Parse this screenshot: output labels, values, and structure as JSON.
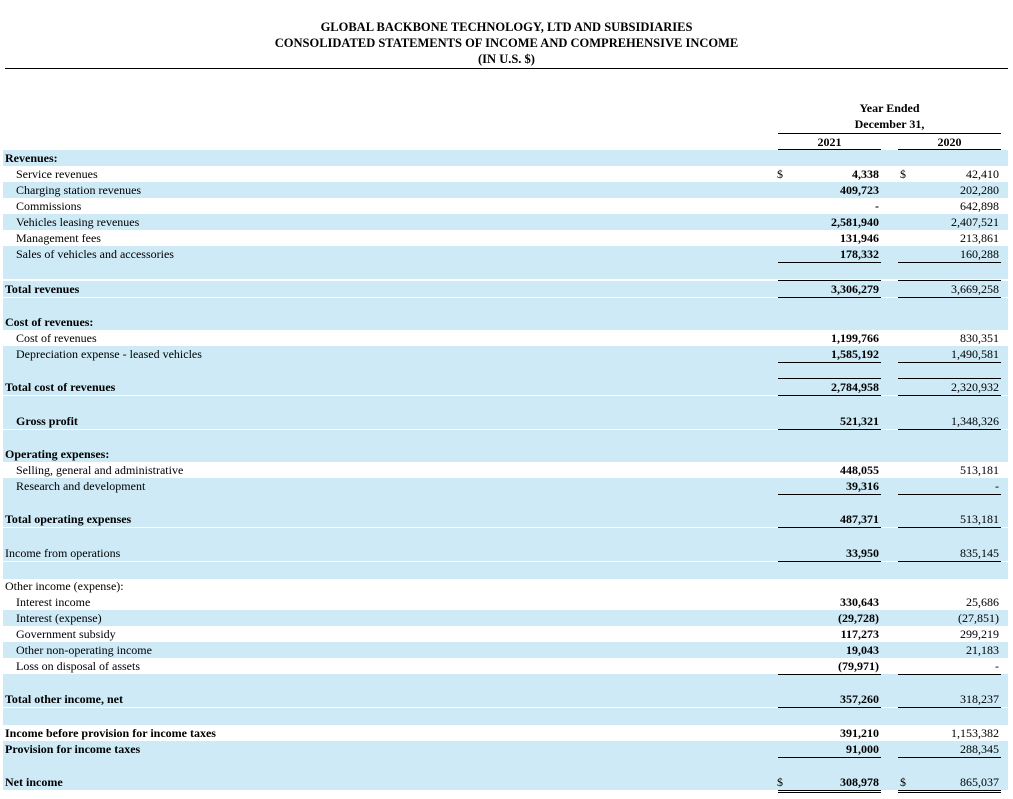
{
  "header": {
    "company": "GLOBAL BACKBONE TECHNOLOGY, LTD AND SUBSIDIARIES",
    "statement": "CONSOLIDATED STATEMENTS OF INCOME AND COMPREHENSIVE INCOME",
    "currency": "(IN U.S. $)"
  },
  "columns": {
    "period_line1": "Year Ended",
    "period_line2": "December 31,",
    "year_a": "2021",
    "year_b": "2020"
  },
  "rows": [
    {
      "label": "Revenues:",
      "v2021": "",
      "v2020": ""
    },
    {
      "label": "Service revenues",
      "cur2021": "$",
      "v2021": "4,338",
      "cur2020": "$",
      "v2020": "42,410"
    },
    {
      "label": "Charging station revenues",
      "v2021": "409,723",
      "v2020": "202,280"
    },
    {
      "label": "Commissions",
      "v2021": "-",
      "v2020": "642,898"
    },
    {
      "label": "Vehicles leasing revenues",
      "v2021": "2,581,940",
      "v2020": "2,407,521"
    },
    {
      "label": "Management fees",
      "v2021": "131,946",
      "v2020": "213,861"
    },
    {
      "label": "Sales of vehicles and accessories",
      "v2021": "178,332",
      "v2020": "160,288"
    },
    {
      "label": "Total revenues",
      "v2021": "3,306,279",
      "v2020": "3,669,258"
    },
    {
      "label": "Cost of revenues:",
      "v2021": "",
      "v2020": ""
    },
    {
      "label": "Cost of revenues",
      "v2021": "1,199,766",
      "v2020": "830,351"
    },
    {
      "label": "Depreciation expense - leased vehicles",
      "v2021": "1,585,192",
      "v2020": "1,490,581"
    },
    {
      "label": "Total cost of revenues",
      "v2021": "2,784,958",
      "v2020": "2,320,932"
    },
    {
      "label": "Gross profit",
      "v2021": "521,321",
      "v2020": "1,348,326"
    },
    {
      "label": "Operating expenses:",
      "v2021": "",
      "v2020": ""
    },
    {
      "label": "Selling, general and administrative",
      "v2021": "448,055",
      "v2020": "513,181"
    },
    {
      "label": "Research and development",
      "v2021": "39,316",
      "v2020": "-"
    },
    {
      "label": "Total operating expenses",
      "v2021": "487,371",
      "v2020": "513,181"
    },
    {
      "label": "Income from operations",
      "v2021": "33,950",
      "v2020": "835,145"
    },
    {
      "label": "Other income (expense):",
      "v2021": "",
      "v2020": ""
    },
    {
      "label": "Interest income",
      "v2021": "330,643",
      "v2020": "25,686"
    },
    {
      "label": "Interest (expense)",
      "v2021": "(29,728)",
      "v2020": "(27,851)"
    },
    {
      "label": "Government subsidy",
      "v2021": "117,273",
      "v2020": "299,219"
    },
    {
      "label": "Other non-operating income",
      "v2021": "19,043",
      "v2020": "21,183"
    },
    {
      "label": "Loss on disposal of assets",
      "v2021": "(79,971)",
      "v2020": "-"
    },
    {
      "label": "Total other income, net",
      "v2021": "357,260",
      "v2020": "318,237"
    },
    {
      "label": "Income before provision for income taxes",
      "v2021": "391,210",
      "v2020": "1,153,382"
    },
    {
      "label": "Provision for income taxes",
      "v2021": "91,000",
      "v2020": "288,345"
    },
    {
      "label": "Net income",
      "cur2021": "$",
      "v2021": "308,978",
      "cur2020": "$",
      "v2020": "865,037"
    }
  ],
  "colors": {
    "row_shade": "#cdeaf6"
  }
}
